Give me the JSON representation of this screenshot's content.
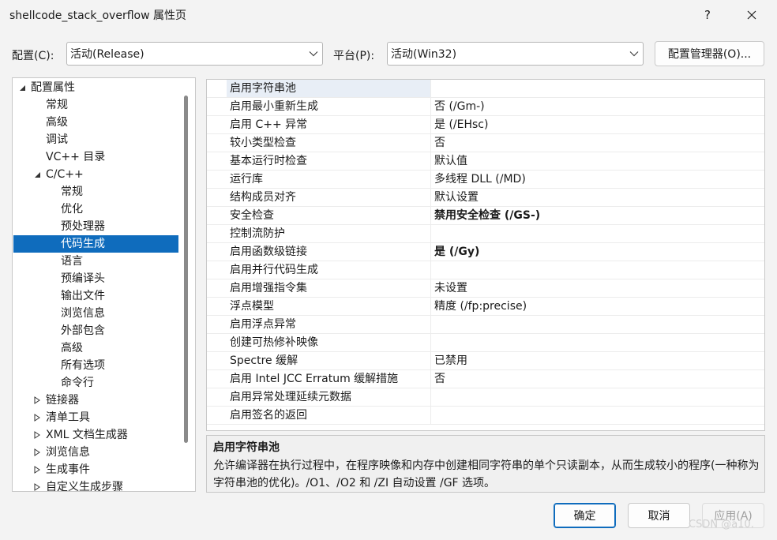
{
  "window": {
    "title": "shellcode_stack_overflow 属性页",
    "help_label": "?",
    "close_icon": "close-icon"
  },
  "config": {
    "config_label": "配置(C):",
    "config_value": "活动(Release)",
    "platform_label": "平台(P):",
    "platform_value": "活动(Win32)",
    "manager_button": "配置管理器(O)..."
  },
  "tree": {
    "items": [
      {
        "label": "配置属性",
        "toggle": "expanded"
      },
      {
        "label": "常规"
      },
      {
        "label": "高级"
      },
      {
        "label": "调试"
      },
      {
        "label": "VC++ 目录"
      },
      {
        "label": "C/C++",
        "toggle": "expanded"
      },
      {
        "label": "常规"
      },
      {
        "label": "优化"
      },
      {
        "label": "预处理器"
      },
      {
        "label": "代码生成",
        "selected": true
      },
      {
        "label": "语言"
      },
      {
        "label": "预编译头"
      },
      {
        "label": "输出文件"
      },
      {
        "label": "浏览信息"
      },
      {
        "label": "外部包含"
      },
      {
        "label": "高级"
      },
      {
        "label": "所有选项"
      },
      {
        "label": "命令行"
      },
      {
        "label": "链接器",
        "toggle": "collapsed"
      },
      {
        "label": "清单工具",
        "toggle": "collapsed"
      },
      {
        "label": "XML 文档生成器",
        "toggle": "collapsed"
      },
      {
        "label": "浏览信息",
        "toggle": "collapsed"
      },
      {
        "label": "生成事件",
        "toggle": "collapsed"
      },
      {
        "label": "自定义生成步骤",
        "toggle": "collapsed"
      }
    ]
  },
  "properties": {
    "rows": [
      {
        "name": "启用字符串池",
        "value": ""
      },
      {
        "name": "启用最小重新生成",
        "value": "否 (/Gm-)"
      },
      {
        "name": "启用 C++ 异常",
        "value": "是 (/EHsc)"
      },
      {
        "name": "较小类型检查",
        "value": "否"
      },
      {
        "name": "基本运行时检查",
        "value": "默认值"
      },
      {
        "name": "运行库",
        "value": "多线程 DLL (/MD)"
      },
      {
        "name": "结构成员对齐",
        "value": "默认设置"
      },
      {
        "name": "安全检查",
        "value": "禁用安全检查 (/GS-)",
        "bold": true
      },
      {
        "name": "控制流防护",
        "value": ""
      },
      {
        "name": "启用函数级链接",
        "value": "是 (/Gy)",
        "bold": true
      },
      {
        "name": "启用并行代码生成",
        "value": ""
      },
      {
        "name": "启用增强指令集",
        "value": "未设置"
      },
      {
        "name": "浮点模型",
        "value": "精度 (/fp:precise)"
      },
      {
        "name": "启用浮点异常",
        "value": ""
      },
      {
        "name": "创建可热修补映像",
        "value": ""
      },
      {
        "name": "Spectre 缓解",
        "value": "已禁用"
      },
      {
        "name": "启用 Intel JCC Erratum 缓解措施",
        "value": "否"
      },
      {
        "name": "启用异常处理延续元数据",
        "value": ""
      },
      {
        "name": "启用签名的返回",
        "value": ""
      }
    ]
  },
  "description": {
    "title": "启用字符串池",
    "text": "允许编译器在执行过程中，在程序映像和内存中创建相同字符串的单个只读副本，从而生成较小的程序(一种称为字符串池的优化)。/O1、/O2 和 /ZI 自动设置 /GF 选项。"
  },
  "buttons": {
    "ok": "确定",
    "cancel": "取消",
    "apply": "应用(A)"
  },
  "watermark": "CSDN @a10.",
  "colors": {
    "accent": "#0f6cbd",
    "selected_text": "#ffffff",
    "highlight_row": "#e8eef6"
  }
}
